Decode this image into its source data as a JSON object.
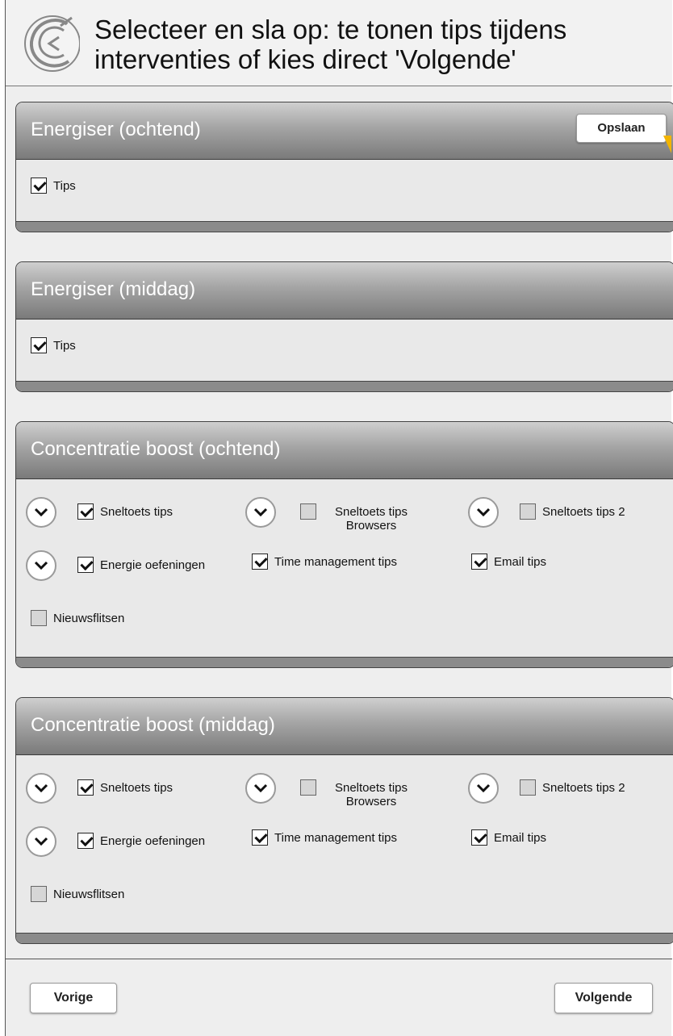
{
  "header": {
    "title": "Selecteer en sla op: te tonen tips tijdens interventies of kies direct 'Volgende'"
  },
  "panels": {
    "p0": {
      "title": "Energiser (ochtend)",
      "save_label": "Opslaan",
      "tips_label": "Tips",
      "tips_checked": true
    },
    "p1": {
      "title": "Energiser (middag)",
      "tips_label": "Tips",
      "tips_checked": true
    },
    "p2": {
      "title": "Concentratie boost (ochtend)",
      "options": [
        {
          "label": "Sneltoets tips",
          "checked": true
        },
        {
          "label": "Sneltoets tips Browsers",
          "checked": false
        },
        {
          "label": "Sneltoets tips 2",
          "checked": false
        },
        {
          "label": "Energie oefeningen",
          "checked": true
        },
        {
          "label": "Time management tips",
          "checked": true
        },
        {
          "label": "Email tips",
          "checked": true
        },
        {
          "label": "Nieuwsflitsen",
          "checked": false
        }
      ]
    },
    "p3": {
      "title": "Concentratie boost (middag)",
      "options": [
        {
          "label": "Sneltoets tips",
          "checked": true
        },
        {
          "label": "Sneltoets tips Browsers",
          "checked": false
        },
        {
          "label": "Sneltoets tips 2",
          "checked": false
        },
        {
          "label": "Energie oefeningen",
          "checked": true
        },
        {
          "label": "Time management tips",
          "checked": true
        },
        {
          "label": "Email tips",
          "checked": true
        },
        {
          "label": "Nieuwsflitsen",
          "checked": false
        }
      ]
    }
  },
  "footer": {
    "prev_label": "Vorige",
    "next_label": "Volgende"
  },
  "icons": {
    "expand": "chevron-down-icon",
    "logo": "c-logo-icon"
  },
  "colors": {
    "header_gradient_top": "#cfcfcf",
    "header_gradient_bottom": "#7a7a7a",
    "accent_cursor": "#f2b400"
  }
}
